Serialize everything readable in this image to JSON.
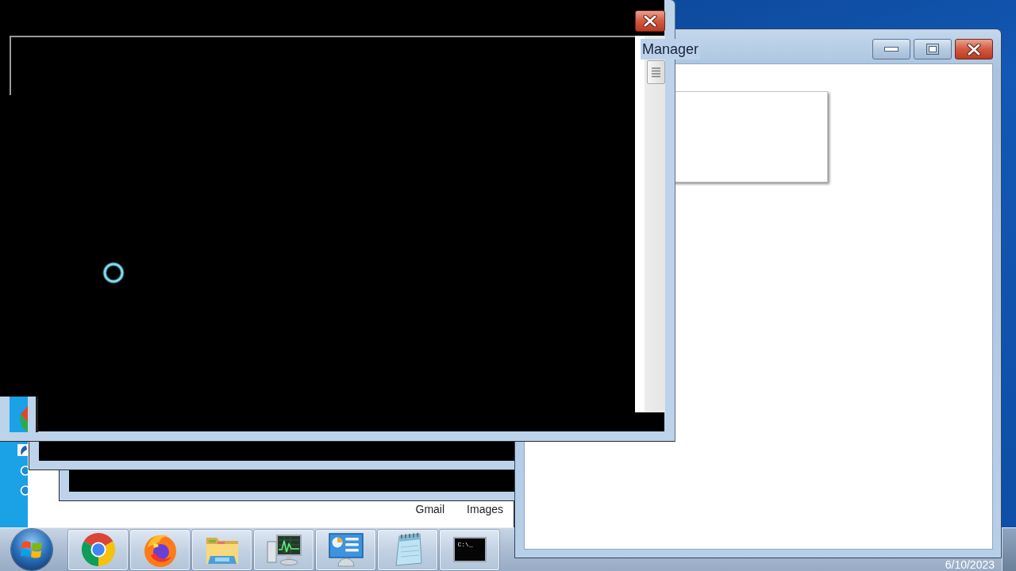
{
  "task_manager": {
    "title": "Manager"
  },
  "browser": {
    "links": [
      "Gmail",
      "Images"
    ]
  },
  "taskbar": {
    "items": [
      {
        "kind": "ring_logo"
      },
      {
        "kind": "fox_logo"
      },
      {
        "kind": "folder"
      },
      {
        "kind": "monitor"
      },
      {
        "kind": "dashboard"
      },
      {
        "kind": "notepad"
      },
      {
        "kind": "console",
        "label": "C:\\_"
      }
    ],
    "date": "6/10/2023"
  }
}
